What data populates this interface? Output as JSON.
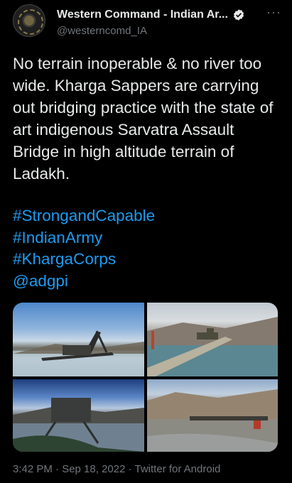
{
  "tweet": {
    "display_name": "Western Command - Indian Ar...",
    "handle": "@westerncomd_IA",
    "more_label": "···",
    "text": "No terrain inoperable & no river too wide. Kharga Sappers are carrying out bridging practice with the state of art indigenous Sarvatra Assault Bridge in high altitude terrain of Ladakh.",
    "hashtags": [
      "#StrongandCapable",
      "#IndianArmy",
      "#KhargaCorps",
      "@adgpi"
    ],
    "timestamp": "3:42 PM · Sep 18, 2022 · Twitter for Android"
  },
  "colors": {
    "background": "#000000",
    "text": "#e7e9ea",
    "link": "#1d9bf0",
    "muted": "#71767b"
  },
  "icons": [
    "verified-badge-icon",
    "more-options-icon"
  ]
}
